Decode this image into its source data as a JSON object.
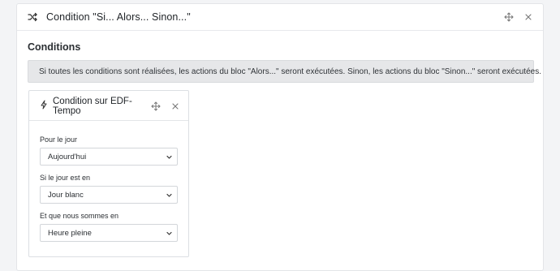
{
  "outer_block": {
    "title": "Condition \"Si... Alors... Sinon...\"",
    "icons": [
      "shuffle-icon",
      "move-icon",
      "close-icon"
    ]
  },
  "conditions": {
    "title": "Conditions",
    "info": "Si toutes les conditions sont réalisées, les actions du bloc \"Alors...\" seront exécutées. Sinon, les actions du bloc \"Sinon...\" seront exécutées."
  },
  "card": {
    "title": "Condition sur EDF-Tempo",
    "icons": [
      "bolt-icon",
      "move-icon",
      "close-icon"
    ],
    "fields": [
      {
        "label": "Pour le jour",
        "value": "Aujourd'hui"
      },
      {
        "label": "Si le jour est en",
        "value": "Jour blanc"
      },
      {
        "label": "Et que nous sommes en",
        "value": "Heure pleine"
      }
    ]
  },
  "colors": {
    "background": "#f3f4f6",
    "panel": "#ffffff",
    "info_box": "#e6e7e9",
    "border": "#dcdfe3",
    "text": "#212529"
  }
}
